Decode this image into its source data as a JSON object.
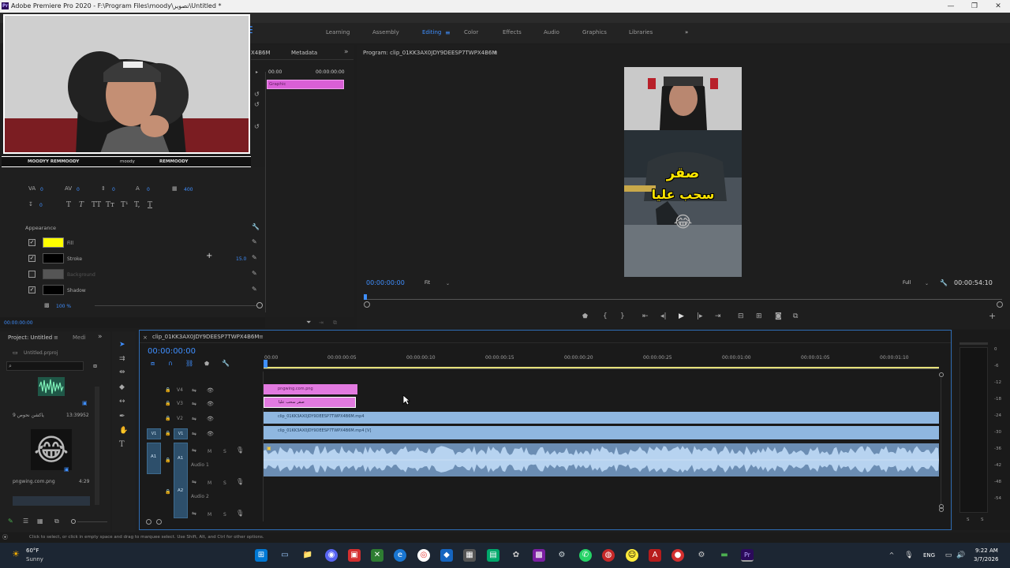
{
  "window": {
    "title": "Adobe Premiere Pro 2020 - F:\\Program Files\\moody\\تصوير\\Untitled *",
    "app_icon": "Pr"
  },
  "workspaces": {
    "tabs": [
      "Learning",
      "Assembly",
      "Editing",
      "Color",
      "Effects",
      "Audio",
      "Graphics",
      "Libraries"
    ],
    "active": "Editing",
    "more": "»"
  },
  "source_panel": {
    "tab_partial": "X4B6M",
    "metadata_tab": "Metadata",
    "timecode_in": "00:00",
    "timecode_out": "00:00:00:00",
    "graphic_clip": "Graphic"
  },
  "essential_graphics": {
    "text_props": [
      {
        "icon": "VA",
        "value": "0"
      },
      {
        "icon": "AV",
        "value": "0"
      },
      {
        "icon": "leading",
        "value": "0"
      },
      {
        "icon": "baseline",
        "value": "0"
      },
      {
        "icon": "tsume",
        "value": "400"
      }
    ],
    "indent_value": "0",
    "style_buttons": [
      "T",
      "T",
      "TT",
      "Tт",
      "T¹",
      "T,",
      "T"
    ],
    "appearance_label": "Appearance",
    "fill_label": "Fill",
    "stroke_label": "Stroke",
    "stroke_width": "15.0",
    "background_label": "Background",
    "shadow_label": "Shadow",
    "shadow_opacity": "100 %",
    "colors": {
      "fill": "#ffff00",
      "stroke": "#000000",
      "background": "#555555",
      "shadow": "#000000"
    },
    "bottom_timecode": "00:00:00:00"
  },
  "program_monitor": {
    "title": "Program: clip_01KK3AX0JDY9DEESP7TWPX4B6M",
    "timecode": "00:00:00:00",
    "fit": "Fit",
    "quality": "Full",
    "duration": "00:00:54:10",
    "caption_line1": "صقر",
    "caption_line2": "سحب عليا",
    "emoji": "😂"
  },
  "project_panel": {
    "title": "Project: Untitled",
    "media_tab": "Medi",
    "file": "Untitled.prproj",
    "item1_name": "ياكشن نحوص 9",
    "item1_duration": "13:39952",
    "item2_name": "pngwing.com.png",
    "item2_duration": "4:29"
  },
  "timeline": {
    "sequence_name": "clip_01KK3AX0JDY9DEESP7TWPX4B6M",
    "timecode": "00:00:00:00",
    "ruler_labels": [
      "00:00",
      "00:00:00:05",
      "00:00:00:10",
      "00:00:00:15",
      "00:00:00:20",
      "00:00:00:25",
      "00:00:01:00",
      "00:00:01:05",
      "00:00:01:10"
    ],
    "tracks": {
      "v4": "V4",
      "v3": "V3",
      "v2": "V2",
      "v1": "V1",
      "a1": "A1",
      "a2": "A2",
      "audio1": "Audio 1",
      "audio2": "Audio 2",
      "m": "M",
      "s": "S"
    },
    "clips": {
      "v4_clip": "pngwing.com.png",
      "v3_clip": "صقر سحب عليا",
      "v2_clip": "clip_01KK3AX0JDY9DEESP7TWPX4B6M.mp4",
      "v1_clip": "clip_01KK3AX0JDY9DEESP7TWPX4B6M.mp4 [V]"
    }
  },
  "status_bar": {
    "text": "Click to select, or click in empty space and drag to marquee select. Use Shift, Alt, and Ctrl for other options."
  },
  "webcam_overlay": {
    "bar_left": "MOODYY REMMOODY",
    "bar_mid": "moody",
    "bar_right": "REMMOODY"
  },
  "taskbar": {
    "weather_temp": "60°F",
    "weather_desc": "Sunny",
    "language": "ENG",
    "time": "9:22 AM",
    "date": "3/7/2026"
  },
  "audio_meter": {
    "labels": [
      "0",
      "-6",
      "-12",
      "-18",
      "-24",
      "-30",
      "-36",
      "-42",
      "-48",
      "-54"
    ],
    "footer_left": "S",
    "footer_right": "S"
  }
}
